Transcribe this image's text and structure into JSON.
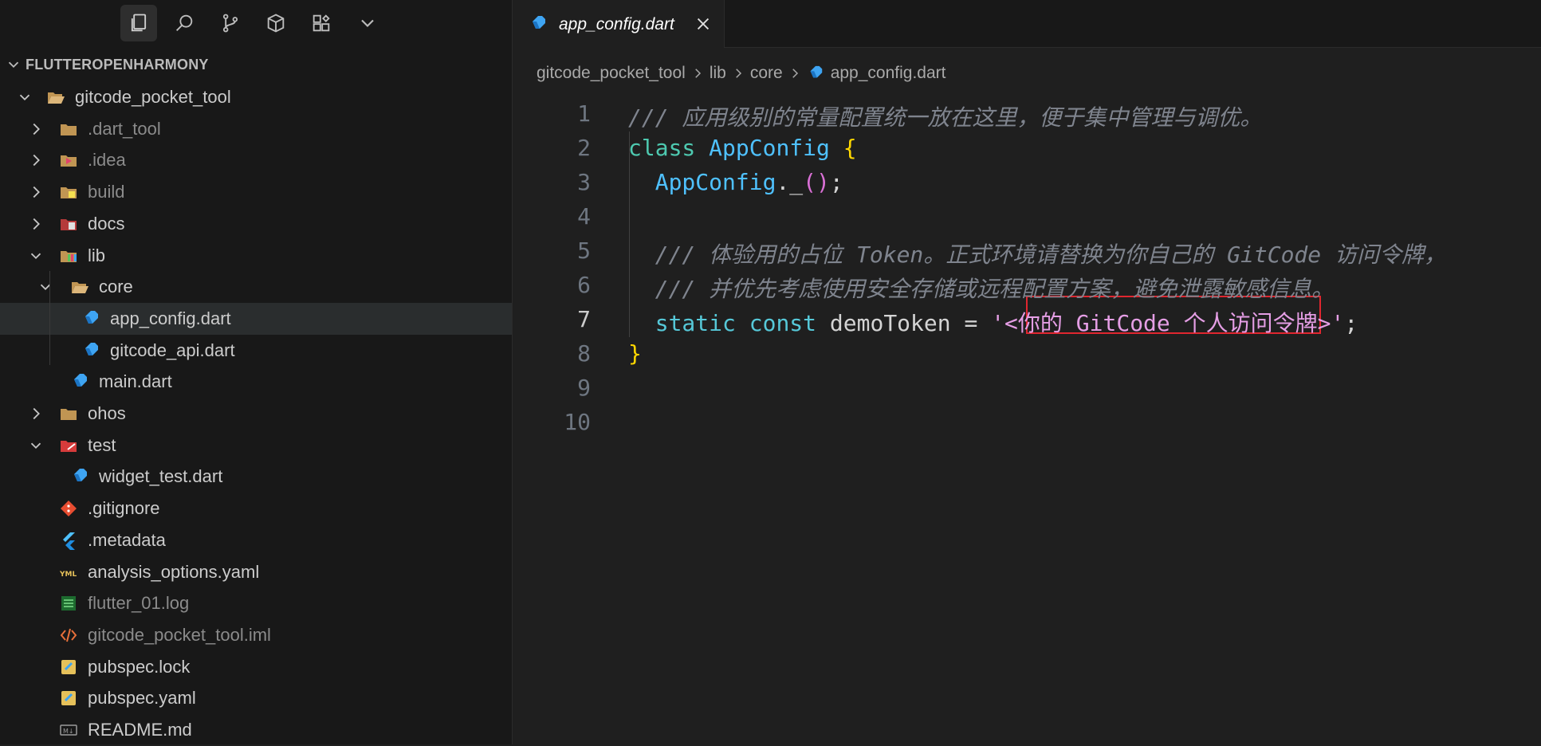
{
  "explorer": {
    "section_title": "FLUTTEROPENHARMONY",
    "items": [
      {
        "label": "gitcode_pocket_tool",
        "depth": 0,
        "kind": "folder-open",
        "expanded": true
      },
      {
        "label": ".dart_tool",
        "depth": 1,
        "kind": "folder",
        "expanded": false,
        "dim": true
      },
      {
        "label": ".idea",
        "depth": 1,
        "kind": "idea-folder",
        "expanded": false,
        "dim": true
      },
      {
        "label": "build",
        "depth": 1,
        "kind": "build-folder",
        "expanded": false,
        "dim": true
      },
      {
        "label": "docs",
        "depth": 1,
        "kind": "docs-folder",
        "expanded": false
      },
      {
        "label": "lib",
        "depth": 1,
        "kind": "lib-folder",
        "expanded": true
      },
      {
        "label": "core",
        "depth": 2,
        "kind": "folder-open",
        "expanded": true
      },
      {
        "label": "app_config.dart",
        "depth": 3,
        "kind": "dart-file",
        "selected": true
      },
      {
        "label": "gitcode_api.dart",
        "depth": 3,
        "kind": "dart-file"
      },
      {
        "label": "main.dart",
        "depth": 2,
        "kind": "dart-file"
      },
      {
        "label": "ohos",
        "depth": 1,
        "kind": "folder",
        "expanded": false
      },
      {
        "label": "test",
        "depth": 1,
        "kind": "test-folder",
        "expanded": true
      },
      {
        "label": "widget_test.dart",
        "depth": 2,
        "kind": "dart-file"
      },
      {
        "label": ".gitignore",
        "depth": 1,
        "kind": "git-file"
      },
      {
        "label": ".metadata",
        "depth": 1,
        "kind": "flutter-file"
      },
      {
        "label": "analysis_options.yaml",
        "depth": 1,
        "kind": "yaml-file"
      },
      {
        "label": "flutter_01.log",
        "depth": 1,
        "kind": "log-file",
        "dim": true
      },
      {
        "label": "gitcode_pocket_tool.iml",
        "depth": 1,
        "kind": "iml-file",
        "dim": true
      },
      {
        "label": "pubspec.lock",
        "depth": 1,
        "kind": "pubspec-file"
      },
      {
        "label": "pubspec.yaml",
        "depth": 1,
        "kind": "pubspec-file"
      },
      {
        "label": "README.md",
        "depth": 1,
        "kind": "md-file"
      }
    ]
  },
  "tab": {
    "label": "app_config.dart"
  },
  "breadcrumb": [
    "gitcode_pocket_tool",
    "lib",
    "core",
    "app_config.dart"
  ],
  "code": {
    "current_line": 7,
    "lines": [
      [
        {
          "t": "/// 应用级别的常量配置统一放在这里，便于集中管理与调优。",
          "c": "c-comment"
        }
      ],
      [
        {
          "t": "class ",
          "c": "c-kw"
        },
        {
          "t": "AppConfig ",
          "c": "c-class"
        },
        {
          "t": "{",
          "c": "c-brace"
        }
      ],
      [
        {
          "t": "  ",
          "c": "c-plain"
        },
        {
          "t": "AppConfig",
          "c": "c-type"
        },
        {
          "t": "._",
          "c": "c-plain"
        },
        {
          "t": "()",
          "c": "c-paren"
        },
        {
          "t": ";",
          "c": "c-punct"
        }
      ],
      [],
      [
        {
          "t": "  /// 体验用的占位 Token。正式环境请替换为你自己的 GitCode 访问令牌，",
          "c": "c-comment"
        }
      ],
      [
        {
          "t": "  /// 并优先考虑使用安全存储或远程配置方案，避免泄露敏感信息。",
          "c": "c-comment"
        }
      ],
      [
        {
          "t": "  ",
          "c": "c-plain"
        },
        {
          "t": "static ",
          "c": "c-kw2"
        },
        {
          "t": "const ",
          "c": "c-kw2"
        },
        {
          "t": "demoToken = ",
          "c": "c-plain"
        },
        {
          "t": "'",
          "c": "c-str"
        },
        {
          "t": "<你的 GitCode 个人访问令牌>",
          "c": "c-str"
        },
        {
          "t": "'",
          "c": "c-str"
        },
        {
          "t": ";",
          "c": "c-punct"
        }
      ],
      [
        {
          "t": "}",
          "c": "c-brace"
        }
      ],
      [],
      []
    ]
  },
  "colors": {
    "accent": "#e0262f",
    "dart": "#3ea4f2"
  }
}
